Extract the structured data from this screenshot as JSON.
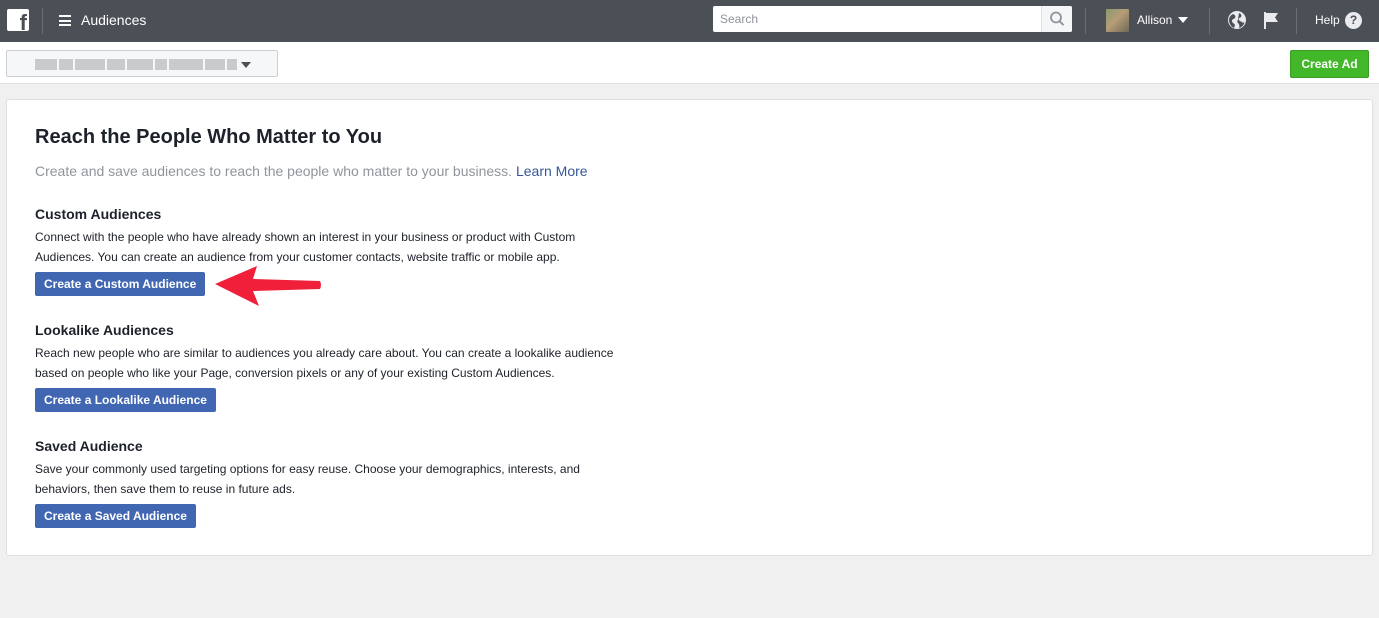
{
  "header": {
    "logo_letter": "f",
    "app_title": "Audiences",
    "search": {
      "placeholder": "Search",
      "value": ""
    },
    "user_name": "Allison",
    "help_label": "Help",
    "help_icon_glyph": "?"
  },
  "subbar": {
    "account_selector": "",
    "create_ad_label": "Create Ad"
  },
  "main": {
    "title": "Reach the People Who Matter to You",
    "subtitle": "Create and save audiences to reach the people who matter to your business.",
    "learn_more": "Learn More",
    "sections": [
      {
        "heading": "Custom Audiences",
        "description": "Connect with the people who have already shown an interest in your business or product with Custom Audiences. You can create an audience from your customer contacts, website traffic or mobile app.",
        "button": "Create a Custom Audience"
      },
      {
        "heading": "Lookalike Audiences",
        "description": "Reach new people who are similar to audiences you already care about. You can create a lookalike audience based on people who like your Page, conversion pixels or any of your existing Custom Audiences.",
        "button": "Create a Lookalike Audience"
      },
      {
        "heading": "Saved Audience",
        "description": "Save your commonly used targeting options for easy reuse. Choose your demographics, interests, and behaviors, then save them to reuse in future ads.",
        "button": "Create a Saved Audience"
      }
    ]
  },
  "colors": {
    "topbar": "#4b4f56",
    "primary_button": "#4267b2",
    "create_ad_button": "#42b72a",
    "link": "#365899",
    "annotation_arrow": "#f0203b"
  },
  "icons": {
    "logo": "facebook-logo-icon",
    "menu": "hamburger-menu-icon",
    "search": "search-icon",
    "user_caret": "caret-down-icon",
    "globe": "globe-icon",
    "flag": "flag-icon",
    "help": "question-circle-icon",
    "annotation": "red-arrow-icon"
  }
}
